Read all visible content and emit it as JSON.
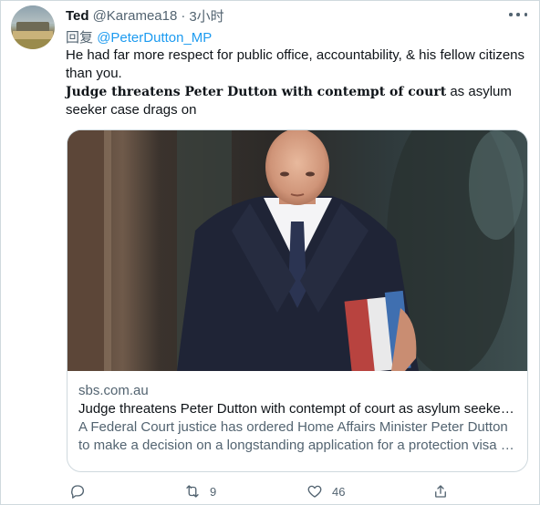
{
  "tweet": {
    "author_name": "Ted",
    "author_handle": "@Karamea18",
    "separator": "·",
    "time": "3小时",
    "reply_prefix": "回复",
    "reply_to": "@PeterDutton_MP",
    "text": "He had far more respect for public office, accountability, & his fellow citizens than you.",
    "headline_bold": "Judge threatens Peter Dutton with contempt of court",
    "headline_rest": " as asylum seeker case drags on"
  },
  "card": {
    "domain": "sbs.com.au",
    "title": "Judge threatens Peter Dutton with contempt of court as asylum seeke…",
    "description_line1": "A Federal Court justice has ordered Home Affairs Minister Peter Dutton",
    "description_line2": "to make a decision on a longstanding application for a protection visa …"
  },
  "actions": {
    "reply_icon": "reply-icon",
    "retweet_icon": "retweet-icon",
    "retweet_count": "9",
    "like_icon": "heart-icon",
    "like_count": "46",
    "share_icon": "share-icon"
  },
  "colors": {
    "accent": "#1d9bf0",
    "secondary_text": "#536471",
    "border": "#cfd9de"
  }
}
